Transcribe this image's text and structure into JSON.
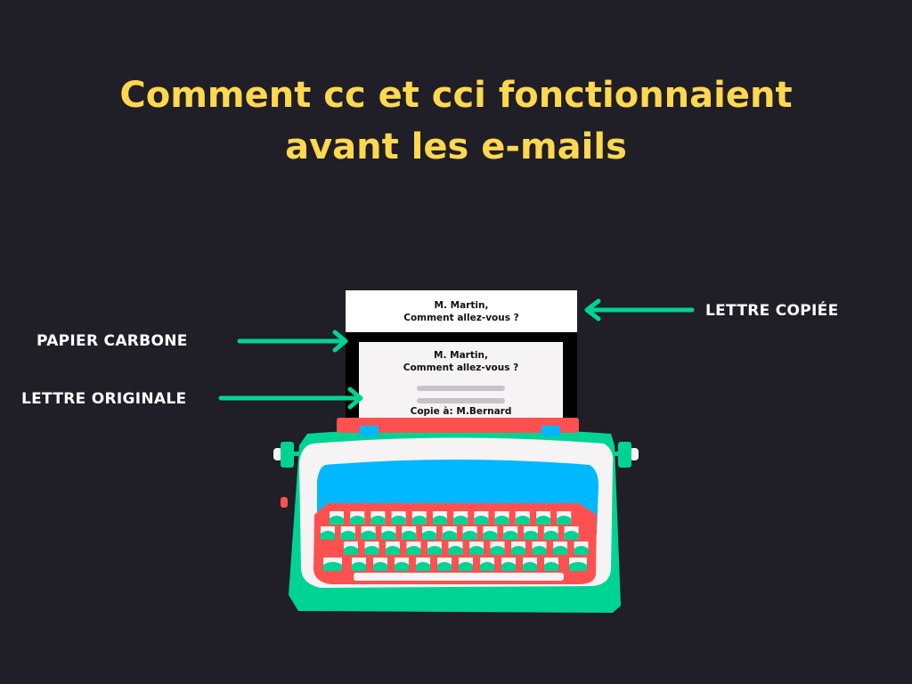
{
  "title": {
    "line1": "Comment cc et cci fonctionnaient",
    "line2": "avant les e-mails"
  },
  "labels": {
    "copied_letter": "LETTRE COPIÉE",
    "carbon_paper": "PAPIER CARBONE",
    "original_letter": "LETTRE ORIGINALE"
  },
  "copy_sheet": {
    "line1": "M. Martin,",
    "line2": "Comment allez-vous ?"
  },
  "original_sheet": {
    "line1": "M. Martin,",
    "line2": "Comment allez-vous ?",
    "cc_line": "Copie à: M.Bernard"
  },
  "colors": {
    "background": "#201e27",
    "title": "#ffd84f",
    "arrow": "#00d494",
    "body": "#00d494",
    "keyboard": "#ff5050",
    "screen": "#00b8ff"
  }
}
